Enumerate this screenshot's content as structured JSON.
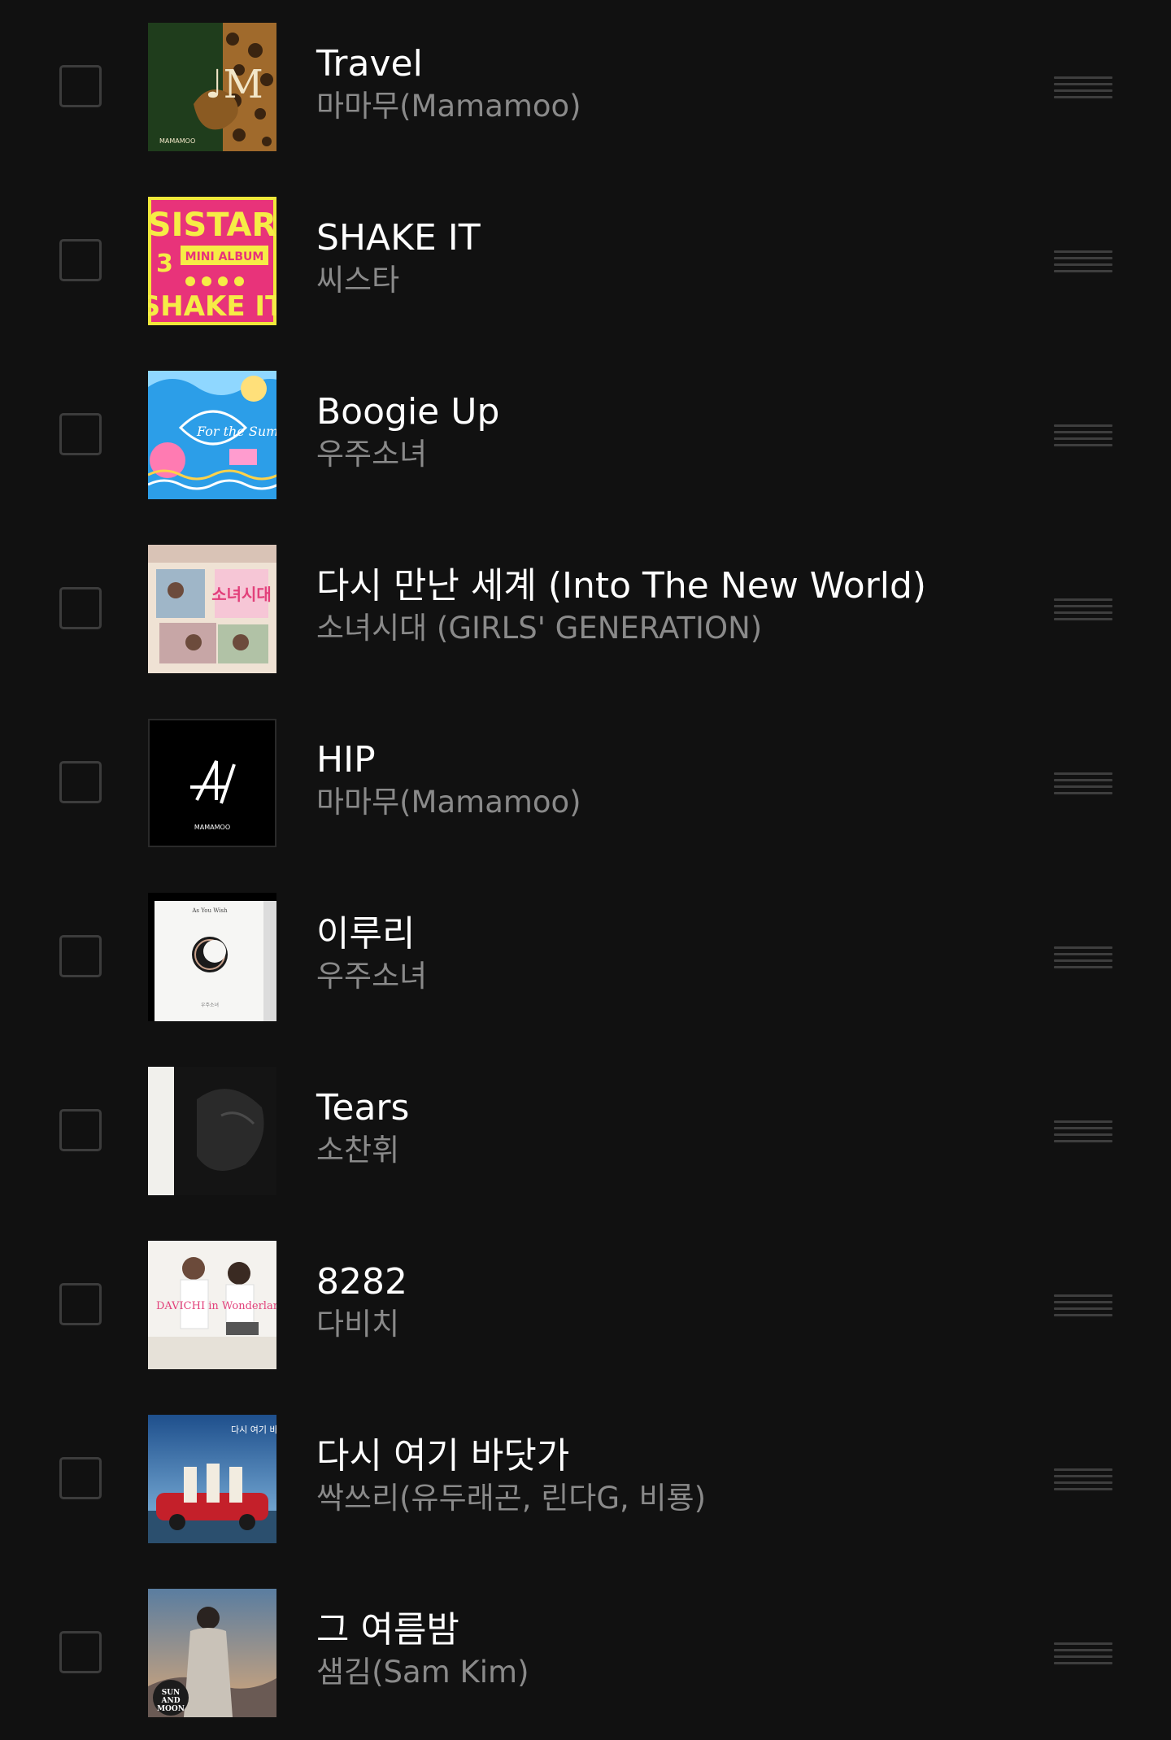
{
  "tracks": [
    {
      "title": "Travel",
      "artist": "마마무(Mamamoo)",
      "cover_text": "MAMAMOO"
    },
    {
      "title": "SHAKE IT",
      "artist": "씨스타",
      "cover_text": "SISTAR · 3RD MINI ALBUM · SHAKE IT"
    },
    {
      "title": "Boogie Up",
      "artist": "우주소녀",
      "cover_text": "For the Summer"
    },
    {
      "title": "다시 만난 세계 (Into The New World)",
      "artist": "소녀시대 (GIRLS' GENERATION)",
      "cover_text": "소녀시대"
    },
    {
      "title": "HIP",
      "artist": "마마무(Mamamoo)",
      "cover_text": "MAMAMOO"
    },
    {
      "title": "이루리",
      "artist": "우주소녀",
      "cover_text": "As You Wish"
    },
    {
      "title": "Tears",
      "artist": "소찬휘",
      "cover_text": ""
    },
    {
      "title": "8282",
      "artist": "다비치",
      "cover_text": "DAVICHI in Wonderland"
    },
    {
      "title": "다시 여기 바닷가",
      "artist": "싹쓰리(유두래곤, 린다G, 비룡)",
      "cover_text": "다시 여기 바닷가"
    },
    {
      "title": "그 여름밤",
      "artist": "샘김(Sam Kim)",
      "cover_text": "SUN AND MOON"
    }
  ],
  "colors": {
    "background": "#111111",
    "title": "#ffffff",
    "artist": "#8a8a8a",
    "control": "#3c3c3c"
  }
}
